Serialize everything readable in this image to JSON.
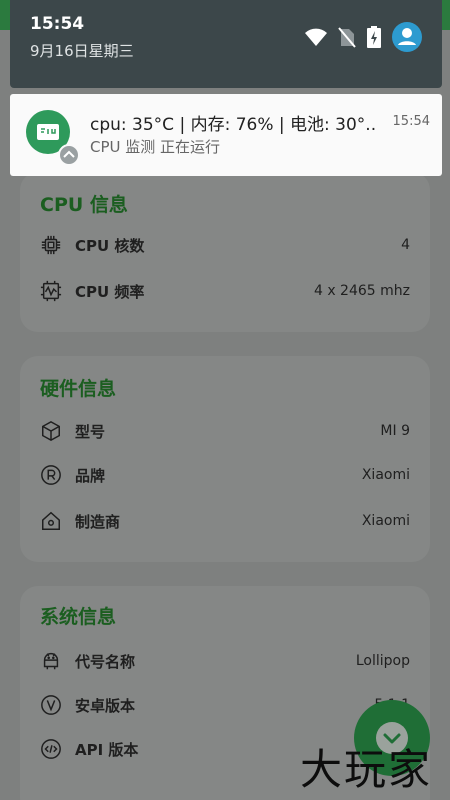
{
  "status_bar": {
    "time": "15:54",
    "date": "9月16日星期三"
  },
  "notification": {
    "title": "cpu: 35°C | 内存: 76% | 电池: 30°..",
    "time": "15:54",
    "text": "CPU 监测 正在运行"
  },
  "cpu_info": {
    "title": "CPU 信息",
    "rows": [
      {
        "label": "CPU 核数",
        "value": "4",
        "icon": "chip-icon"
      },
      {
        "label": "CPU 频率",
        "value": "4 x 2465 mhz",
        "icon": "frequency-icon"
      }
    ]
  },
  "hardware_info": {
    "title": "硬件信息",
    "rows": [
      {
        "label": "型号",
        "value": "MI 9",
        "icon": "cube-icon"
      },
      {
        "label": "品牌",
        "value": "Xiaomi",
        "icon": "registered-icon"
      },
      {
        "label": "制造商",
        "value": "Xiaomi",
        "icon": "home-icon"
      }
    ]
  },
  "system_info": {
    "title": "系统信息",
    "rows": [
      {
        "label": "代号名称",
        "value": "Lollipop",
        "icon": "android-icon"
      },
      {
        "label": "安卓版本",
        "value": "5.1.1",
        "icon": "version-icon"
      },
      {
        "label": "API 版本",
        "value": "",
        "icon": "code-icon"
      }
    ]
  },
  "watermark": "大玩家",
  "colors": {
    "accent_green": "#1b5e20",
    "shade": "#3c474a",
    "fab": "#1f6e36"
  }
}
